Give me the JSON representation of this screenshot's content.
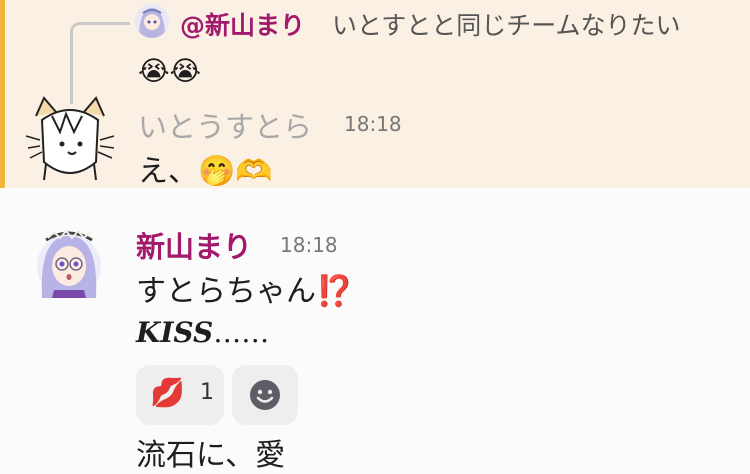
{
  "reply_preview": {
    "mention": "@新山まり",
    "text": "いとすとと同じチームなりたい",
    "emoji": "😭😭"
  },
  "message1": {
    "author": "いとうすとら",
    "time": "18:18",
    "text": "え、🤭🫶"
  },
  "message2": {
    "author": "新山まり",
    "time": "18:18",
    "text": "すとらちゃん⁉️",
    "kiss_bold": "KISS",
    "kiss_dots": "……",
    "reaction": {
      "emoji": "💋",
      "count": "1"
    },
    "text2": "流石に、愛"
  },
  "colors": {
    "highlight_bg": "#faf0e3",
    "highlight_bar": "#f1b63b",
    "name_accent": "#a3196b"
  },
  "icons": {
    "add_reaction": "smiley-icon"
  }
}
